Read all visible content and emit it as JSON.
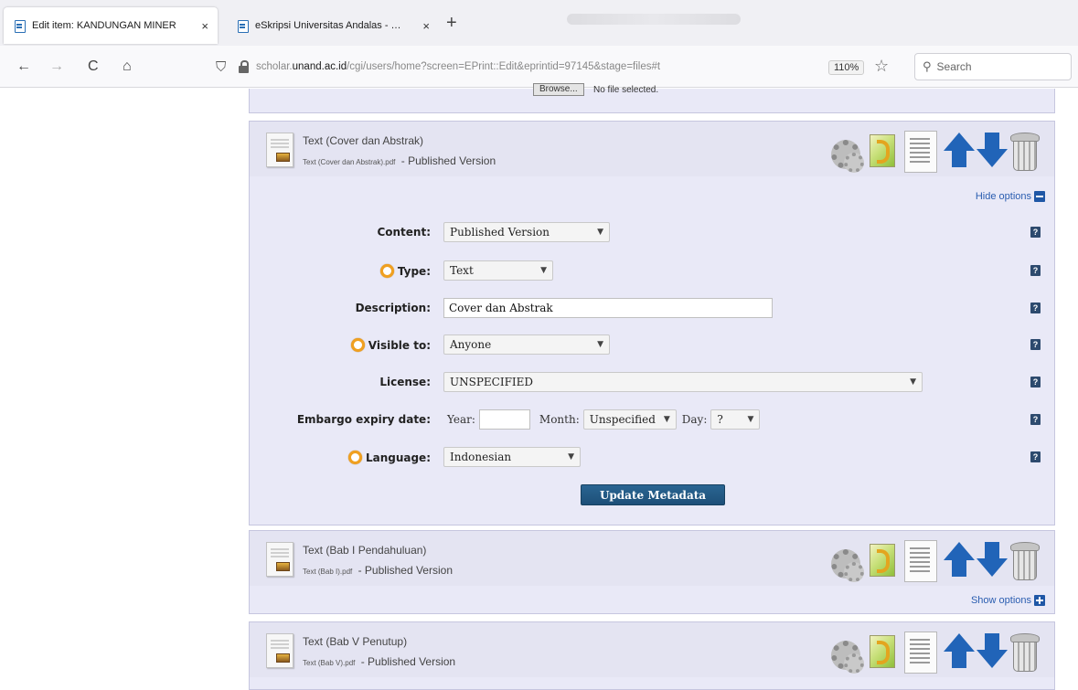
{
  "browser": {
    "tabs": [
      {
        "title": "Edit item: KANDUNGAN MINER",
        "close": "×"
      },
      {
        "title": "eSkripsi Universitas Andalas - …",
        "close": "×"
      }
    ],
    "new_tab": "+",
    "nav": {
      "back": "←",
      "forward": "→",
      "reload": "C",
      "home": "⌂"
    },
    "url_prefix": "scholar.",
    "url_host": "unand.ac.id",
    "url_path": "/cgi/users/home?screen=EPrint::Edit&eprintid=97145&stage=files#t",
    "zoom": "110%",
    "star": "☆",
    "search_placeholder": "Search"
  },
  "page": {
    "browse_label": "Browse...",
    "browse_note": "No file selected.",
    "docs": [
      {
        "title": "Text (Cover dan Abstrak)",
        "filename": "Text (Cover dan Abstrak).pdf",
        "version": "- Published Version",
        "toggle": "Hide options"
      },
      {
        "title": "Text (Bab I Pendahuluan)",
        "filename": "Text (Bab I).pdf",
        "version": "- Published Version",
        "toggle": "Show options"
      },
      {
        "title": "Text (Bab V Penutup)",
        "filename": "Text (Bab V).pdf",
        "version": "- Published Version"
      }
    ],
    "form": {
      "content": {
        "label": "Content:",
        "value": "Published Version"
      },
      "type": {
        "label": "Type:",
        "value": "Text"
      },
      "description": {
        "label": "Description:",
        "value": "Cover dan Abstrak"
      },
      "visible": {
        "label": "Visible to:",
        "value": "Anyone"
      },
      "license": {
        "label": "License:",
        "value": "UNSPECIFIED"
      },
      "embargo": {
        "label": "Embargo expiry date:",
        "year_label": "Year:",
        "year_value": "",
        "month_label": "Month:",
        "month_value": "Unspecified",
        "day_label": "Day:",
        "day_value": "?"
      },
      "language": {
        "label": "Language:",
        "value": "Indonesian"
      },
      "help": "?",
      "update_button": "Update Metadata"
    }
  },
  "colors": {
    "panel": "#e9e9f7",
    "accent": "#2164b8",
    "button": "#1d4f78"
  }
}
